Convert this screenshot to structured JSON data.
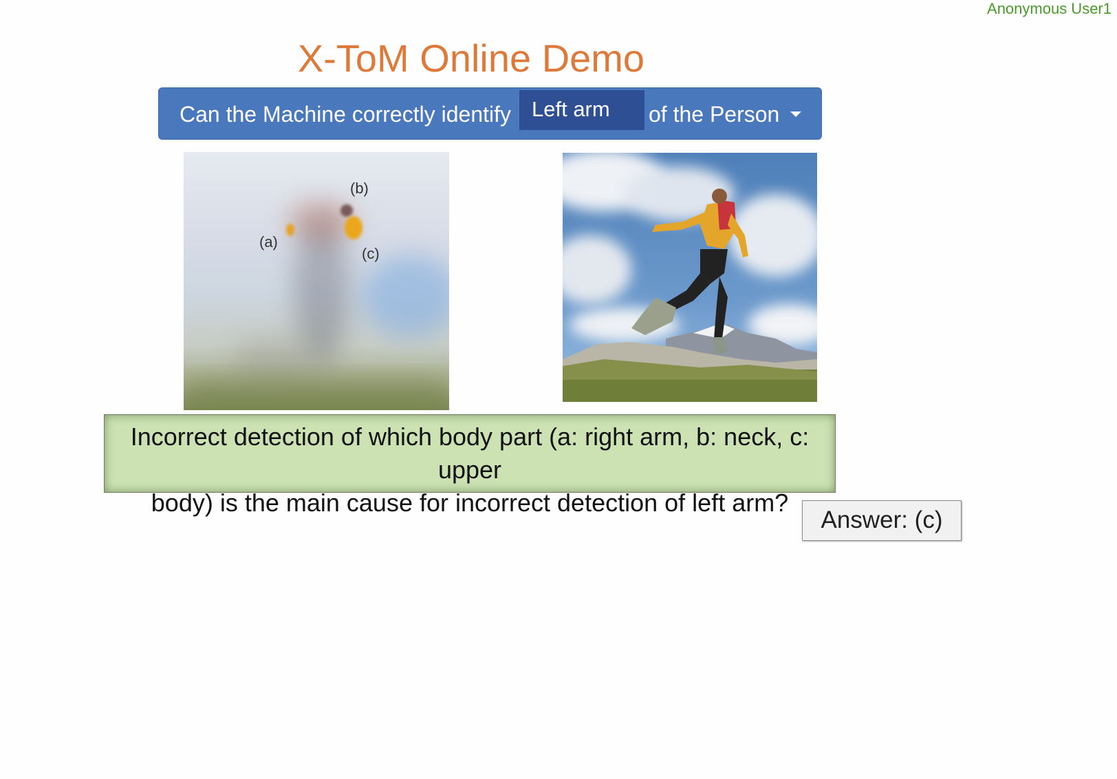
{
  "header": {
    "user": "Anonymous User1"
  },
  "title": "X-ToM Online Demo",
  "question_bar": {
    "prefix": "Can the Machine correctly identify",
    "selected_part": "Left arm",
    "suffix": "of the Person"
  },
  "left_image": {
    "markers": {
      "a": "(a)",
      "b": "(b)",
      "c": "(c)"
    }
  },
  "prompt": {
    "line1": "Incorrect detection of which body part (a: right arm, b: neck, c: upper",
    "line2": "body) is the main cause for incorrect detection of left arm?"
  },
  "answer_button": "Answer: (c)",
  "colors": {
    "title": "#dd7a3a",
    "user": "#4a9a2a",
    "bar": "#4a78bd",
    "select": "#2f4f95",
    "prompt_bg": "#cce2b3"
  }
}
